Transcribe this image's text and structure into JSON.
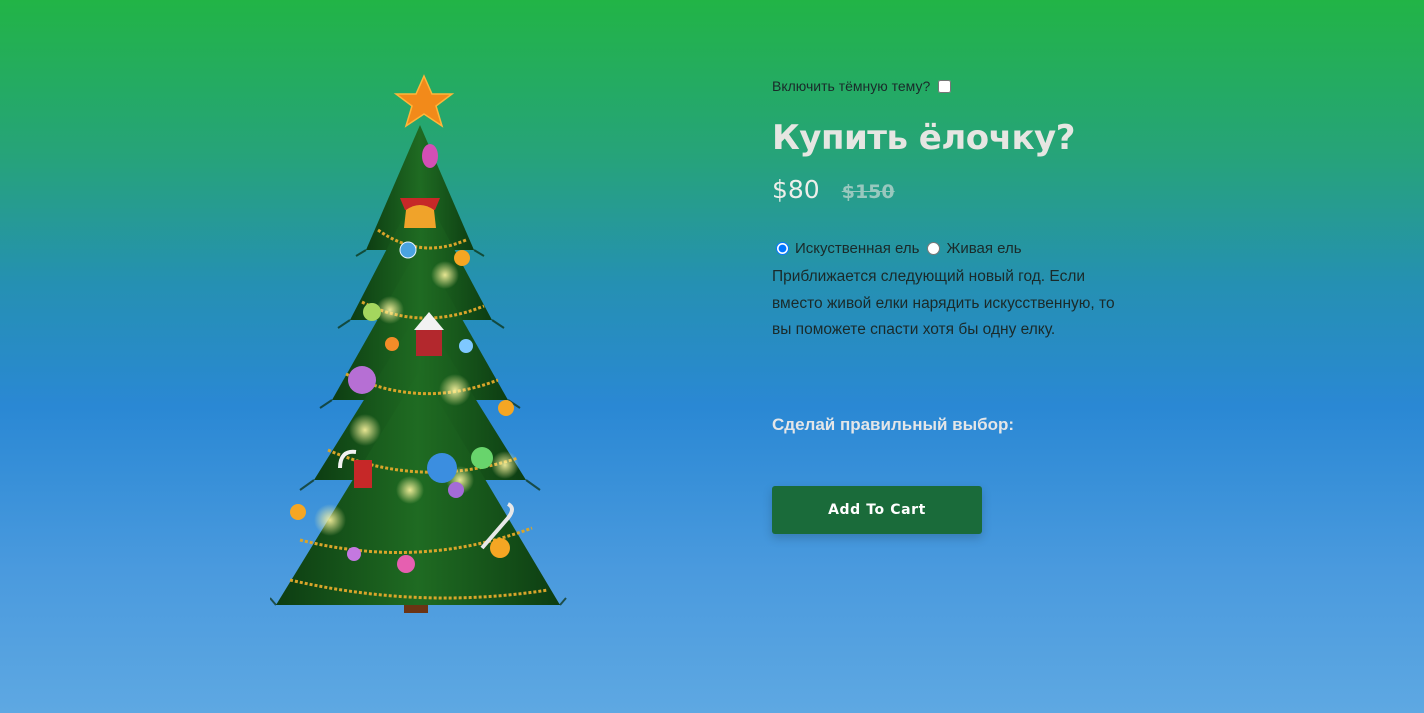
{
  "theme_toggle": {
    "label": "Включить тёмную тему?",
    "checked": false
  },
  "product": {
    "title": "Купить ёлочку?",
    "price_current": "$80",
    "price_old": "$150",
    "options": [
      {
        "label": "Искуственная ель",
        "selected": true
      },
      {
        "label": "Живая ель",
        "selected": false
      }
    ],
    "description": "Приближается следующий новый год. Если вместо живой елки нарядить искусственную, то вы поможете спасти хотя бы одну елку.",
    "cta_label": "Сделай правильный выбор:",
    "add_to_cart_label": "Add To Cart"
  },
  "colors": {
    "button_bg": "#1a6b3a",
    "title": "#e6e6e2",
    "gradient_top": "#22b446",
    "gradient_bottom": "#5ea8e2"
  },
  "icons": {
    "product_image": "christmas-tree-icon",
    "tree_topper": "star-icon"
  }
}
